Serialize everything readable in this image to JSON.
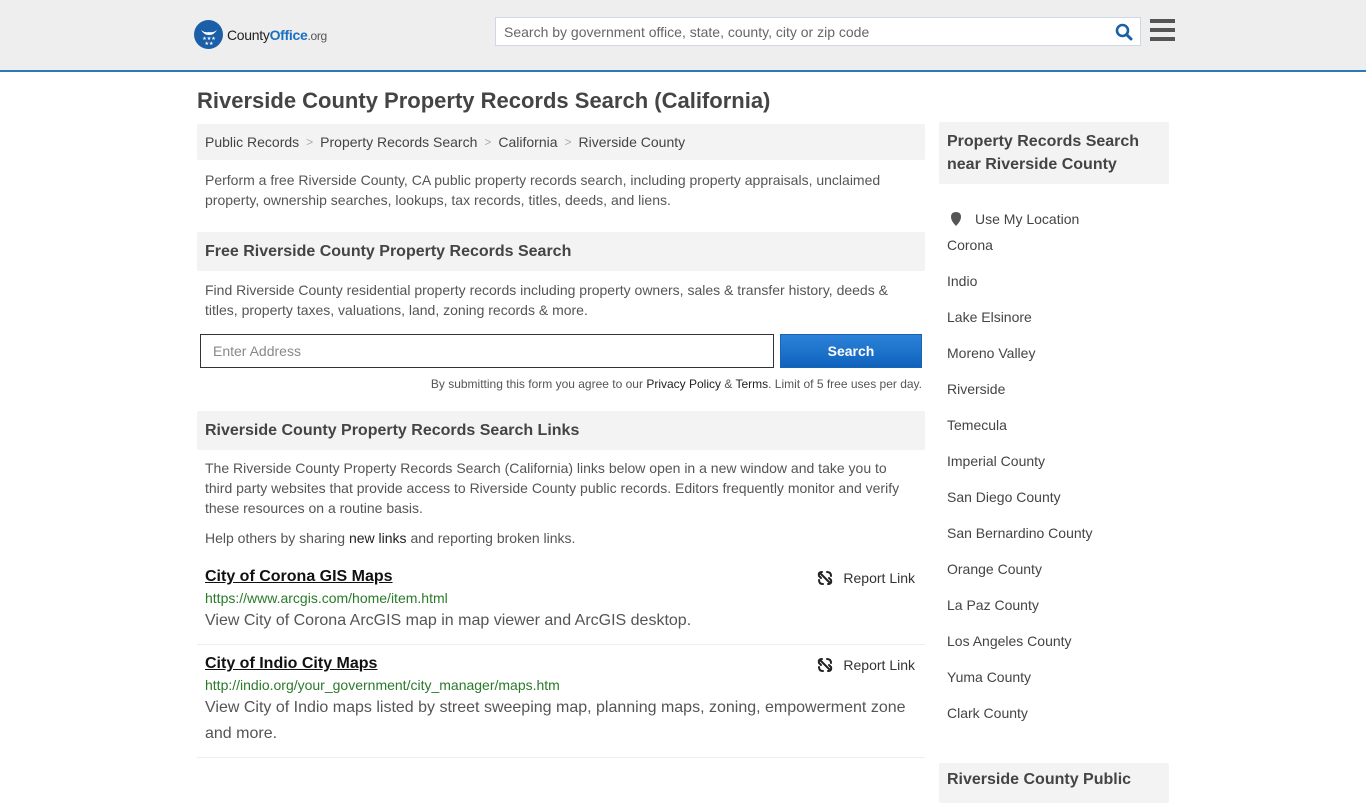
{
  "header": {
    "logo": {
      "county": "County",
      "office": "Office",
      "org": ".org"
    },
    "search_placeholder": "Search by government office, state, county, city or zip code"
  },
  "page_title": "Riverside County Property Records Search (California)",
  "breadcrumb": [
    "Public Records",
    "Property Records Search",
    "California",
    "Riverside County"
  ],
  "intro": "Perform a free Riverside County, CA public property records search, including property appraisals, unclaimed property, ownership searches, lookups, tax records, titles, deeds, and liens.",
  "free_search": {
    "heading": "Free Riverside County Property Records Search",
    "text": "Find Riverside County residential property records including property owners, sales & transfer history, deeds & titles, property taxes, valuations, land, zoning records & more.",
    "input_placeholder": "Enter Address",
    "button_label": "Search",
    "disclaimer_prefix": "By submitting this form you agree to our ",
    "privacy_label": "Privacy Policy",
    "amp": " & ",
    "terms_label": "Terms",
    "disclaimer_suffix": ". Limit of 5 free uses per day."
  },
  "links_section": {
    "heading": "Riverside County Property Records Search Links",
    "text": "The Riverside County Property Records Search (California) links below open in a new window and take you to third party websites that provide access to Riverside County public records. Editors frequently monitor and verify these resources on a routine basis.",
    "help_prefix": "Help others by sharing ",
    "help_link": "new links",
    "help_suffix": " and reporting broken links.",
    "report_label": "Report Link",
    "items": [
      {
        "title": "City of Corona GIS Maps",
        "url": "https://www.arcgis.com/home/item.html",
        "description": "View City of Corona ArcGIS map in map viewer and ArcGIS desktop."
      },
      {
        "title": "City of Indio City Maps",
        "url": "http://indio.org/your_government/city_manager/maps.htm",
        "description": "View City of Indio maps listed by street sweeping map, planning maps, zoning, empowerment zone and more."
      }
    ]
  },
  "sidebar": {
    "heading": "Property Records Search near Riverside County",
    "use_location": "Use My Location",
    "places": [
      "Corona",
      "Indio",
      "Lake Elsinore",
      "Moreno Valley",
      "Riverside",
      "Temecula",
      "Imperial County",
      "San Diego County",
      "San Bernardino County",
      "Orange County",
      "La Paz County",
      "Los Angeles County",
      "Yuma County",
      "Clark County"
    ],
    "next_heading": "Riverside County Public"
  }
}
